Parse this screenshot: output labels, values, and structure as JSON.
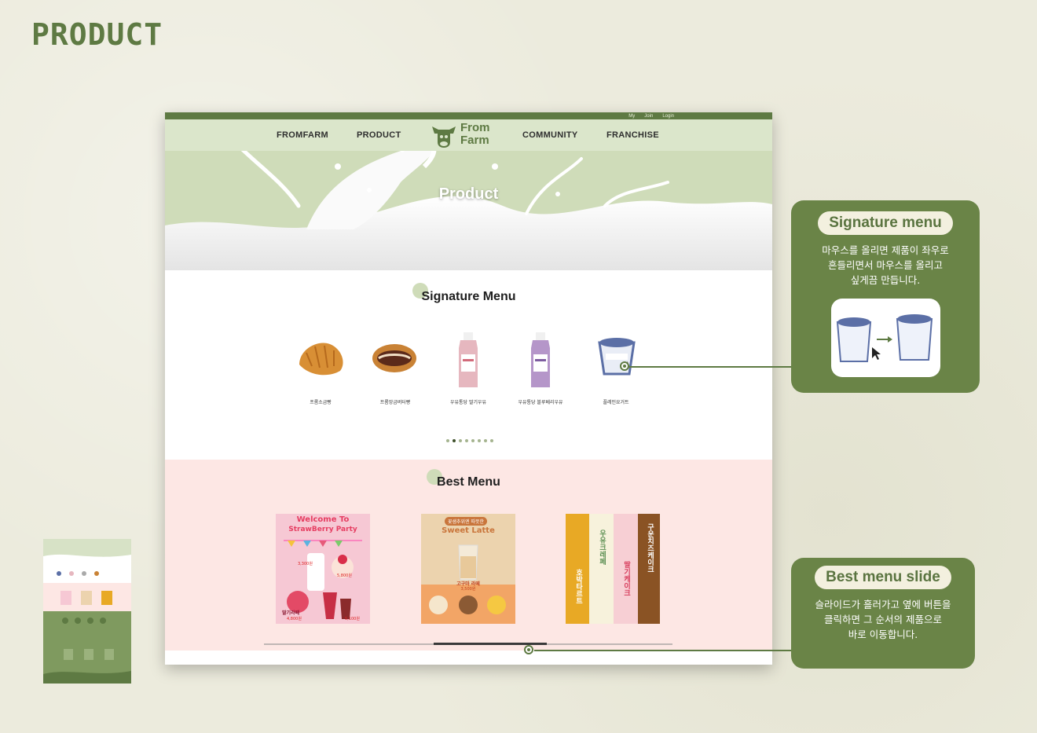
{
  "page": {
    "title": "PRODUCT"
  },
  "site": {
    "topbar": [
      "My",
      "Join",
      "Login"
    ],
    "nav": {
      "left": [
        "FROMFARM",
        "PRODUCT"
      ],
      "right": [
        "COMMUNITY",
        "FRANCHISE"
      ]
    },
    "logo": {
      "line1": "From",
      "line2": "Farm"
    },
    "hero_title": "Product",
    "signature": {
      "title": "Signature Menu",
      "products": [
        "프롬소금빵",
        "프롬앙금버터빵",
        "우유통당 딸기우유",
        "우유통당 블루베리우유",
        "플레인요거트"
      ],
      "pager_count": 8,
      "pager_active": 2
    },
    "best": {
      "title": "Best Menu",
      "cards": [
        {
          "heading": "Welcome To",
          "sub": "StrawBerry Party",
          "tag": "딸기라떼",
          "price1": "3,300원",
          "price2": "5,800원",
          "price3": "4,800원",
          "price4": "5,100원"
        },
        {
          "badge": "꽃샘추위엔 따뜻한",
          "heading": "Sweet Latte",
          "tag": "고구마 라떼",
          "price": "3,500원"
        },
        {
          "col1": "호박타르트",
          "col2": "우유크레페",
          "col3": "딸기케이크",
          "col4": "구운치즈케이크"
        }
      ],
      "slider_position": 0.42
    }
  },
  "callouts": {
    "signature": {
      "title": "Signature menu",
      "text1": "마우스를 올리면 제품이 좌우로",
      "text2": "흔들리면서 마우스를 올리고",
      "text3": "싶게끔 만듭니다."
    },
    "best": {
      "title": "Best menu slide",
      "text1": "슬라이드가 흘러가고 옆에 버튼을",
      "text2": "클릭하면 그 순서의 제품으로",
      "text3": "바로 이동합니다."
    }
  },
  "colors": {
    "brand": "#5e7a43",
    "callout": "#6a8447",
    "hero": "#cfdcb9",
    "best_bg": "#fde7e4"
  }
}
